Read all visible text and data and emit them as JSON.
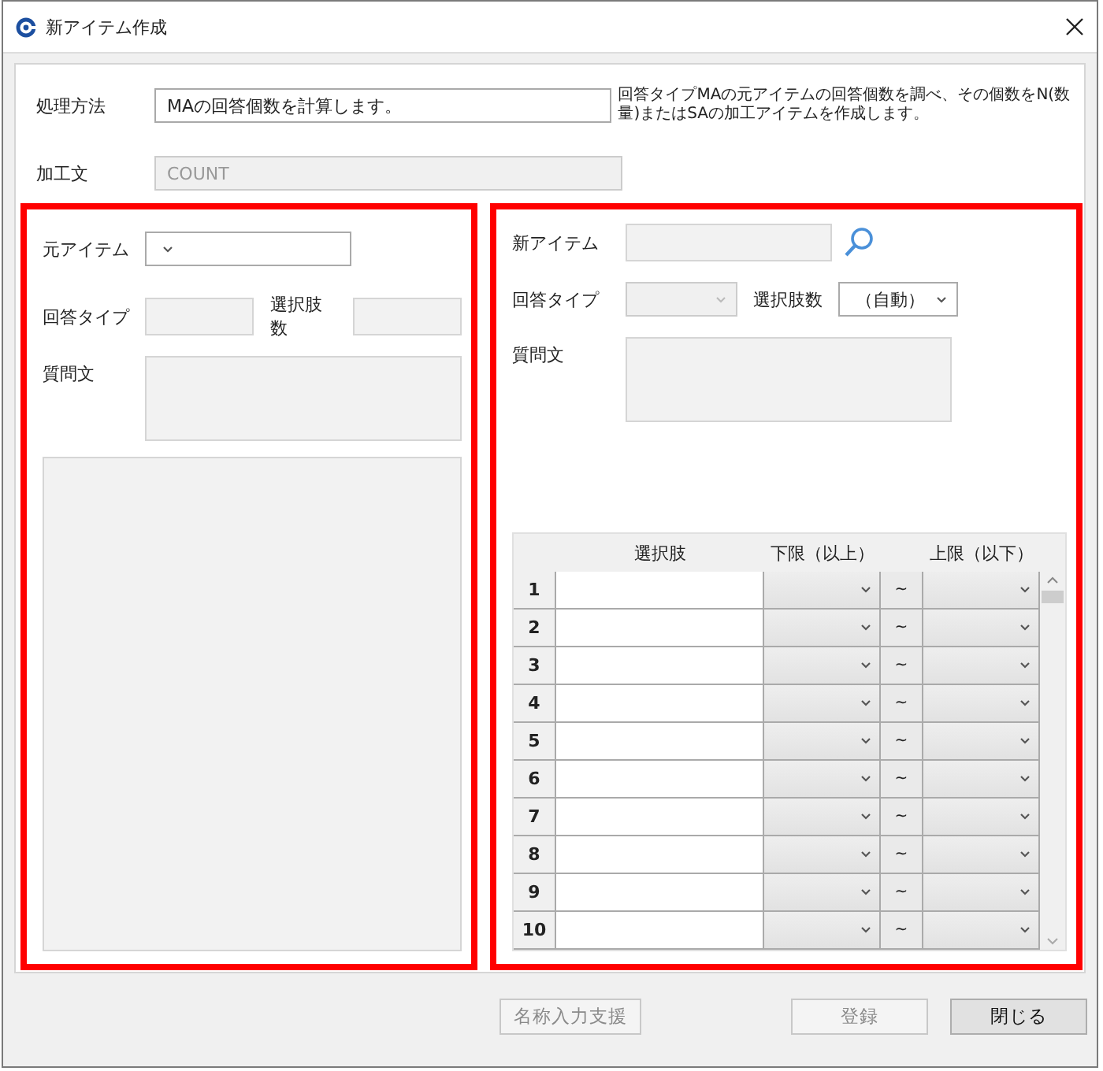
{
  "window": {
    "title": "新アイテム作成"
  },
  "process": {
    "label": "処理方法",
    "value": "MAの回答個数を計算します。",
    "description": "回答タイプMAの元アイテムの回答個数を調べ、その個数をN(数量)またはSAの加工アイテムを作成します。"
  },
  "formula": {
    "label": "加工文",
    "value": "COUNT",
    "disabled": true
  },
  "source_panel": {
    "item_label": "元アイテム",
    "answer_type_label": "回答タイプ",
    "choice_count_label": "選択肢数",
    "question_label": "質問文"
  },
  "new_panel": {
    "item_label": "新アイテム",
    "answer_type_label": "回答タイプ",
    "answer_type_disabled": true,
    "choice_count_label": "選択肢数",
    "choice_count_value": "（自動）",
    "question_label": "質問文",
    "table": {
      "columns": [
        "選択肢",
        "下限（以上）",
        "上限（以下）"
      ],
      "rows": [
        {
          "number": "1",
          "separator": "~"
        },
        {
          "number": "2",
          "separator": "~"
        },
        {
          "number": "3",
          "separator": "~"
        },
        {
          "number": "4",
          "separator": "~"
        },
        {
          "number": "5",
          "separator": "~"
        },
        {
          "number": "6",
          "separator": "~"
        },
        {
          "number": "7",
          "separator": "~"
        },
        {
          "number": "8",
          "separator": "~"
        },
        {
          "number": "9",
          "separator": "~"
        },
        {
          "number": "10",
          "separator": "~"
        }
      ]
    }
  },
  "buttons": [
    {
      "label": "名称入力支援",
      "disabled": true
    },
    {
      "label": "登録",
      "disabled": true
    },
    {
      "label": "閉じる",
      "disabled": false
    }
  ]
}
